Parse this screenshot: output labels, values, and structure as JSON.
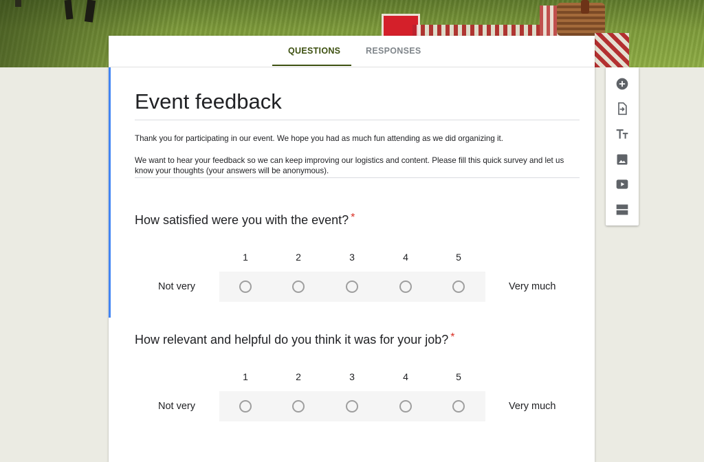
{
  "tabs": [
    {
      "label": "QUESTIONS",
      "active": true
    },
    {
      "label": "RESPONSES",
      "active": false
    }
  ],
  "form": {
    "title": "Event feedback",
    "description": [
      "Thank you for participating in our event. We hope you had as much fun attending as we did organizing it.",
      "We want to hear your feedback so we can keep improving our logistics and content. Please fill this quick survey and let us know your thoughts (your answers will be anonymous)."
    ]
  },
  "questions": [
    {
      "text": "How satisfied were you with the event?",
      "required_mark": "*",
      "scale": [
        "1",
        "2",
        "3",
        "4",
        "5"
      ],
      "low_label": "Not very",
      "high_label": "Very much"
    },
    {
      "text": "How relevant and helpful do you think it was for your job?",
      "required_mark": "*",
      "scale": [
        "1",
        "2",
        "3",
        "4",
        "5"
      ],
      "low_label": "Not very",
      "high_label": "Very much"
    }
  ],
  "toolbar_icons": [
    "add-question-icon",
    "import-questions-icon",
    "add-title-icon",
    "add-image-icon",
    "add-video-icon",
    "add-section-icon"
  ],
  "colors": {
    "accent": "#4285f4",
    "tab_active": "#3d5010",
    "required": "#d93025",
    "page_background": "#ebebe3"
  }
}
